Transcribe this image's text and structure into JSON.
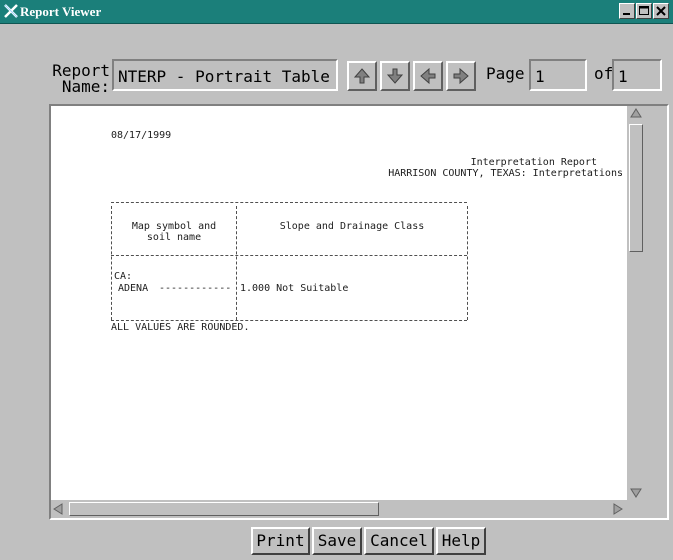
{
  "window": {
    "title": "Report Viewer"
  },
  "toolbar": {
    "report_name_label": "Report\nName:",
    "report_name_value": "NTERP - Portrait Table",
    "page_label": "Page",
    "page_value": "1",
    "of_label": "of",
    "of_value": "1"
  },
  "report": {
    "date": "08/17/1999",
    "title": "Interpretation Report",
    "subtitle": "HARRISON COUNTY, TEXAS: Interpretations",
    "table": {
      "header_col1_line1": "Map symbol and",
      "header_col1_line2": "soil name",
      "header_col2": "Slope and Drainage Class",
      "group_label": "CA:",
      "row_name": "ADENA",
      "row_dashes": "------------",
      "row_value": "1.000 Not Suitable"
    },
    "footer_note": "ALL VALUES ARE ROUNDED."
  },
  "buttons": {
    "print": "Print",
    "save": "Save",
    "cancel": "Cancel",
    "help": "Help"
  },
  "colors": {
    "titlebar": "#1b7f7a",
    "window_bg": "#c0c0c0"
  }
}
